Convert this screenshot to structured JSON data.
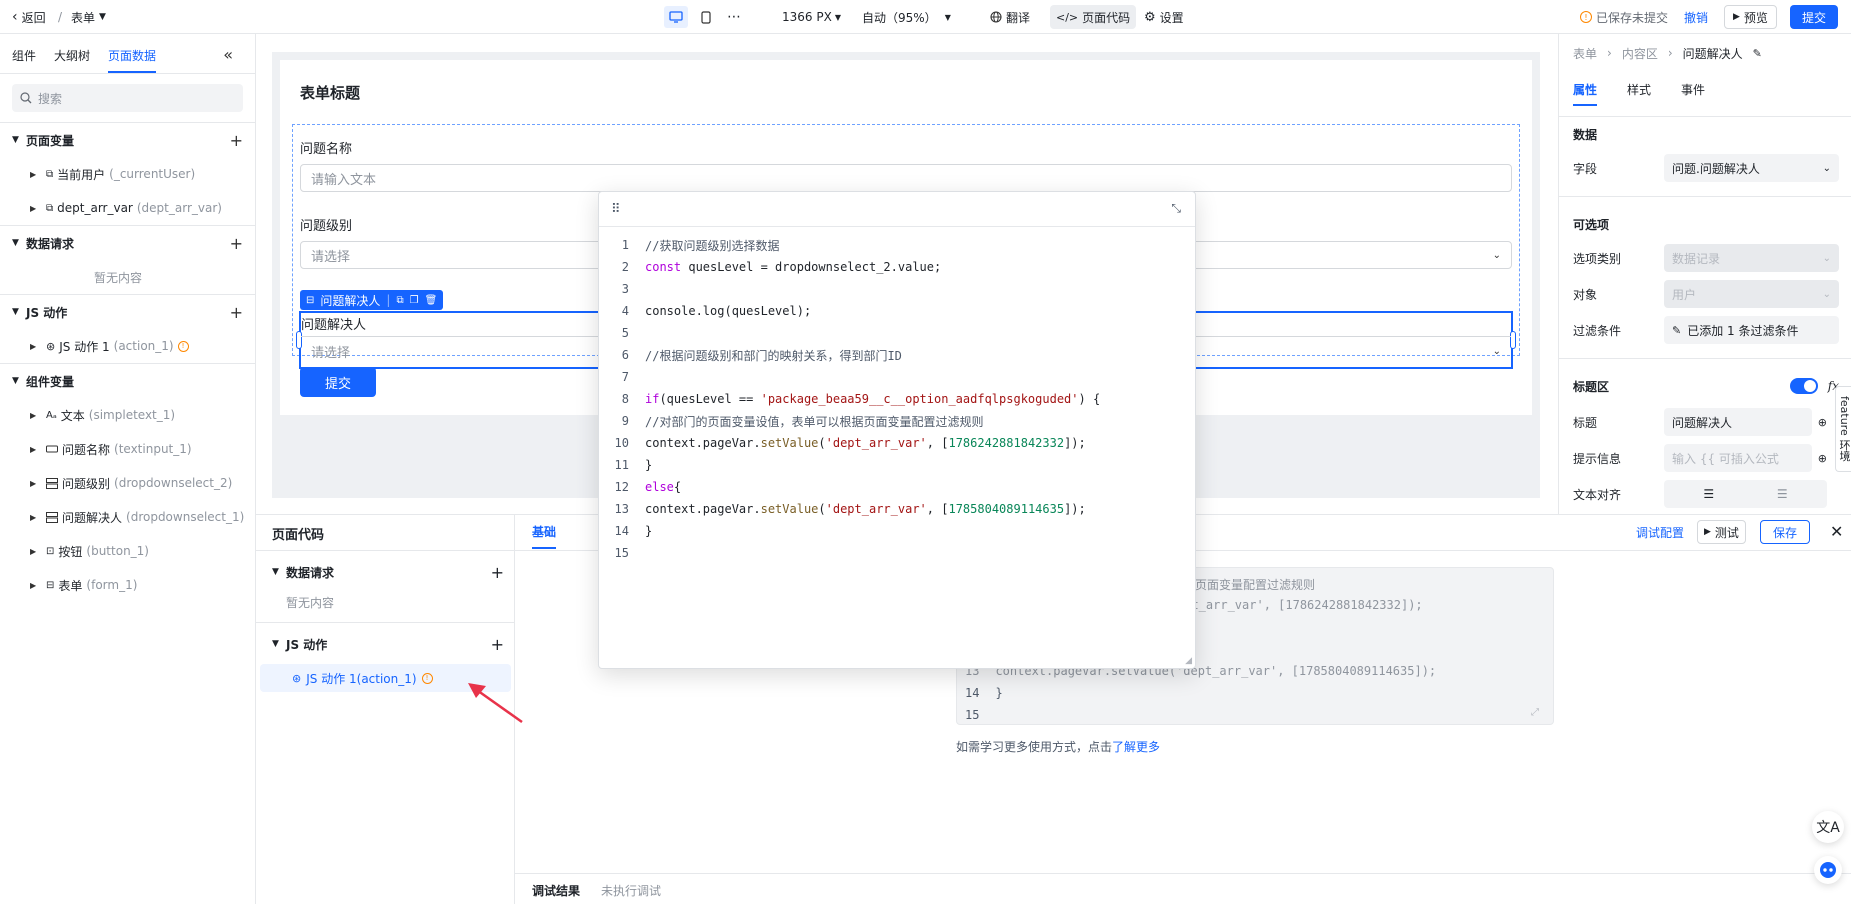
{
  "topbar": {
    "back_label": "返回",
    "slash": "/",
    "page_name": "表单",
    "width_value": "1366 PX",
    "zoom_value": "自动（95%）",
    "translate_label": "翻译",
    "page_code_label": "页面代码",
    "settings_label": "设置",
    "unsaved_status": "已保存未提交",
    "undo_label": "撤销",
    "preview_label": "预览",
    "submit_label": "提交"
  },
  "left": {
    "tabs": [
      "组件",
      "大纲树",
      "页面数据"
    ],
    "search_placeholder": "搜索",
    "page_vars_title": "页面变量",
    "page_vars": [
      {
        "name": "当前用户",
        "id": "(_currentUser)"
      },
      {
        "name": "dept_arr_var",
        "id": "(dept_arr_var)"
      }
    ],
    "data_requests_title": "数据请求",
    "empty_label": "暂无内容",
    "js_actions_title": "JS 动作",
    "js_actions": [
      {
        "name": "JS 动作 1",
        "id": "(action_1)"
      }
    ],
    "component_vars_title": "组件变量",
    "component_vars": [
      {
        "name": "文本",
        "id": "(simpletext_1)",
        "icon": "text-icon"
      },
      {
        "name": "问题名称",
        "id": "(textinput_1)",
        "icon": "input-icon"
      },
      {
        "name": "问题级别",
        "id": "(dropdownselect_2)",
        "icon": "select-icon"
      },
      {
        "name": "问题解决人",
        "id": "(dropdownselect_1)",
        "icon": "select-icon"
      },
      {
        "name": "按钮",
        "id": "(button_1)",
        "icon": "button-icon"
      },
      {
        "name": "表单",
        "id": "(form_1)",
        "icon": "form-icon"
      }
    ]
  },
  "form": {
    "title": "表单标题",
    "field1_label": "问题名称",
    "field1_placeholder": "请输入文本",
    "field2_label": "问题级别",
    "field2_placeholder": "请选择",
    "field3_label": "问题解决人",
    "field3_placeholder": "请选择",
    "selected_chip_label": "问题解决人",
    "submit_label": "提交"
  },
  "right": {
    "breadcrumb": [
      "表单",
      "内容区",
      "问题解决人"
    ],
    "tabs": [
      "属性",
      "样式",
      "事件"
    ],
    "data_section": "数据",
    "field_label": "字段",
    "field_value": "问题.问题解决人",
    "options_section": "可选项",
    "option_type_label": "选项类别",
    "option_type_value": "数据记录",
    "object_label": "对象",
    "object_value": "用户",
    "filter_label": "过滤条件",
    "filter_value": "已添加 1 条过滤条件",
    "title_area_label": "标题区",
    "title_area_on": true,
    "fx_label": "fx",
    "title_label": "标题",
    "title_value": "问题解决人",
    "hint_label": "提示信息",
    "hint_placeholder": "输入 {{ 可插入公式",
    "align_label": "文本对齐",
    "feature_tab": "feature 环境"
  },
  "bottom": {
    "panel_title": "页面代码",
    "data_requests_title": "数据请求",
    "empty_label": "暂无内容",
    "js_actions_title": "JS 动作",
    "js_action_item": "JS 动作 1(action_1)",
    "basic_tab": "基础",
    "debug_config": "调试配置",
    "test_label": "测试",
    "save_label": "保存",
    "bg_code": [
      {
        "n": "",
        "t": "根据页面变量配置过滤规则"
      },
      {
        "n": "",
        "t": "ept_arr_var', [1786242881842332]);"
      },
      {
        "n": "13",
        "t": "context.pageVar.setValue('dept_arr_var', [1785804089114635]);"
      },
      {
        "n": "14",
        "t": "}"
      },
      {
        "n": "15",
        "t": ""
      }
    ],
    "learn_more_prefix": "如需学习更多使用方式，点击",
    "learn_more_link": "了解更多",
    "result_tab": "调试结果",
    "result_status": "未执行调试"
  },
  "code_popup": {
    "lines": [
      "//获取问题级别选择数据",
      "const quesLevel = dropdownselect_2.value;",
      "",
      "console.log(quesLevel);",
      "",
      "//根据问题级别和部门的映射关系，得到部门ID",
      "",
      "if(quesLevel == 'package_beaa59__c__option_aadfqlpsgkoguded') {",
      "//对部门的页面变量设值，表单可以根据页面变量配置过滤规则",
      "context.pageVar.setValue('dept_arr_var', [1786242881842332]);",
      "}",
      "else{",
      "context.pageVar.setValue('dept_arr_var', [1785804089114635]);",
      "}",
      ""
    ]
  },
  "colors": {
    "accent": "#1664ff",
    "warning": "#ff8800",
    "arrow": "#e8334a"
  }
}
